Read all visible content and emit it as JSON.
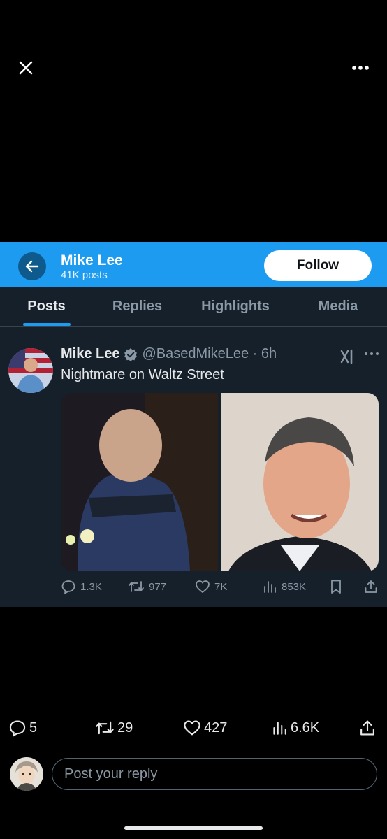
{
  "top": {
    "close_icon": "close-icon",
    "more_icon": "more-icon"
  },
  "embed": {
    "header": {
      "name": "Mike Lee",
      "posts": "41K posts",
      "follow_label": "Follow",
      "bg_color": "#1d9bf0"
    },
    "tabs": [
      {
        "label": "Posts",
        "active": true
      },
      {
        "label": "Replies",
        "active": false
      },
      {
        "label": "Highlights",
        "active": false
      },
      {
        "label": "Media",
        "active": false
      }
    ],
    "tweet": {
      "author": "Mike Lee",
      "handle_time": "@BasedMikeLee · 6h",
      "text": "Nightmare on Waltz Street",
      "actions": {
        "replies": "1.3K",
        "reposts": "977",
        "likes": "7K",
        "views": "853K"
      }
    }
  },
  "post_actions": {
    "replies": "5",
    "reposts": "29",
    "likes": "427",
    "views": "6.6K"
  },
  "reply": {
    "placeholder": "Post your reply"
  },
  "colors": {
    "accent": "#1d9bf0",
    "background": "#000000",
    "embed_bg": "#15202b"
  }
}
